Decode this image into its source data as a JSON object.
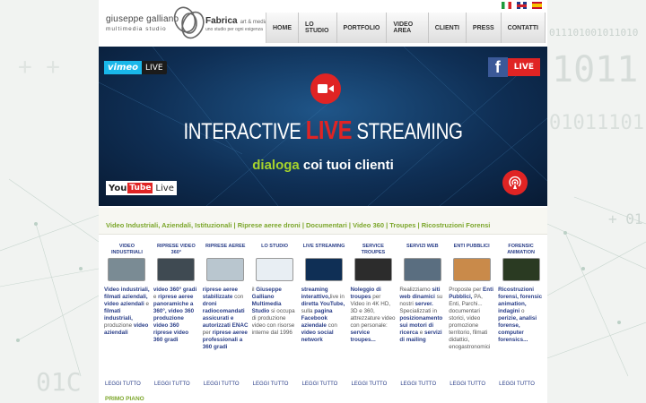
{
  "background": {
    "binary_1": "1011",
    "binary_2": "011101001011010",
    "binary_3": "01011101",
    "binary_4": "+ 01",
    "binary_5": "01C",
    "binary_6": "+ +"
  },
  "logo": {
    "name_line1": "giuseppe galliano",
    "name_line2": "multimedia studio",
    "fabrica": "Fabrica",
    "fabrica_tag": "art & media",
    "fabrica_sub": "uno studio per ogni esigenza"
  },
  "nav": {
    "items": [
      "HOME",
      "LO STUDIO",
      "PORTFOLIO",
      "VIDEO AREA",
      "CLIENTI",
      "PRESS",
      "CONTATTI"
    ]
  },
  "languages": [
    "Italiano",
    "English",
    "Español"
  ],
  "banner": {
    "vimeo": "vimeo",
    "vimeo_live": "LIVE",
    "facebook": "f",
    "facebook_live": "LIVE",
    "title_pre": "INTERACTIVE ",
    "title_live": "LIVE",
    "title_post": " STREAMING",
    "tag_green": "dialoga",
    "tag_white": " coi tuoi clienti",
    "youtube_you": "You",
    "youtube_tube": "Tube",
    "youtube_live": "Live"
  },
  "subline": "Video Industriali, Aziendali, Istituzionali | Riprese aeree droni | Documentari | Video 360 | Troupes | Ricostruzioni Forensi",
  "columns": [
    {
      "heading": "VIDEO INDUSTRIALI",
      "text": "Video industriali, filmati aziendali, video aziendali e filmati industriali, produzione video aziendali",
      "more": "LEGGI TUTTO",
      "thumb_color": "#7a8b94"
    },
    {
      "heading": "RIPRESE VIDEO 360°",
      "text": "video 360° gradi e riprese aeree panoramiche a 360°, video 360 produzione video 360 riprese video 360 gradi",
      "more": "LEGGI TUTTO",
      "thumb_color": "#3f4a52"
    },
    {
      "heading": "RIPRESE AEREE",
      "text": "riprese aeree stabilizzate con droni radiocomandati assicurati e autorizzati ENAC per riprese aeree professionali a 360 gradi",
      "more": "LEGGI TUTTO",
      "thumb_color": "#b9c6cf"
    },
    {
      "heading": "LO STUDIO",
      "text": "il Giuseppe Galliano Multimedia Studio si occupa di produzione video con risorse interne dal 1996",
      "more": "LEGGI TUTTO",
      "thumb_color": "#e8eef3"
    },
    {
      "heading": "LIVE STREAMING",
      "text": "streaming interattivo,live in diretta YouTube, sulla pagina Facebook aziendale con video social network",
      "more": "LEGGI TUTTO",
      "thumb_color": "#0f2f55"
    },
    {
      "heading": "SERVICE TROUPES",
      "text": "Noleggio di troupes per Video in 4K HD, 3D e 360, attrezzature video con personale: service troupes...",
      "more": "LEGGI TUTTO",
      "thumb_color": "#2c2c2c"
    },
    {
      "heading": "SERVIZI WEB",
      "text": "Realizziamo siti web dinamici su nostri server. Specializzati in posizionamento sui motori di ricerca e servizi di mailing",
      "more": "LEGGI TUTTO",
      "thumb_color": "#5a6e80"
    },
    {
      "heading": "ENTI PUBBLICI",
      "text": "Proposte per Enti Pubblici, PA, Enti, Parchi... documentari storici, video promozione territorio, filmati didattici, enogastronomici",
      "more": "LEGGI TUTTO",
      "thumb_color": "#c98a4a"
    },
    {
      "heading": "FORENSIC ANIMATION",
      "text": "Ricostruzioni forensi, forensic animation, indagini o perizie, analisi forense, computer forensics...",
      "more": "LEGGI TUTTO",
      "thumb_color": "#2a3a22"
    }
  ],
  "primo_piano": "PRIMO PIANO"
}
